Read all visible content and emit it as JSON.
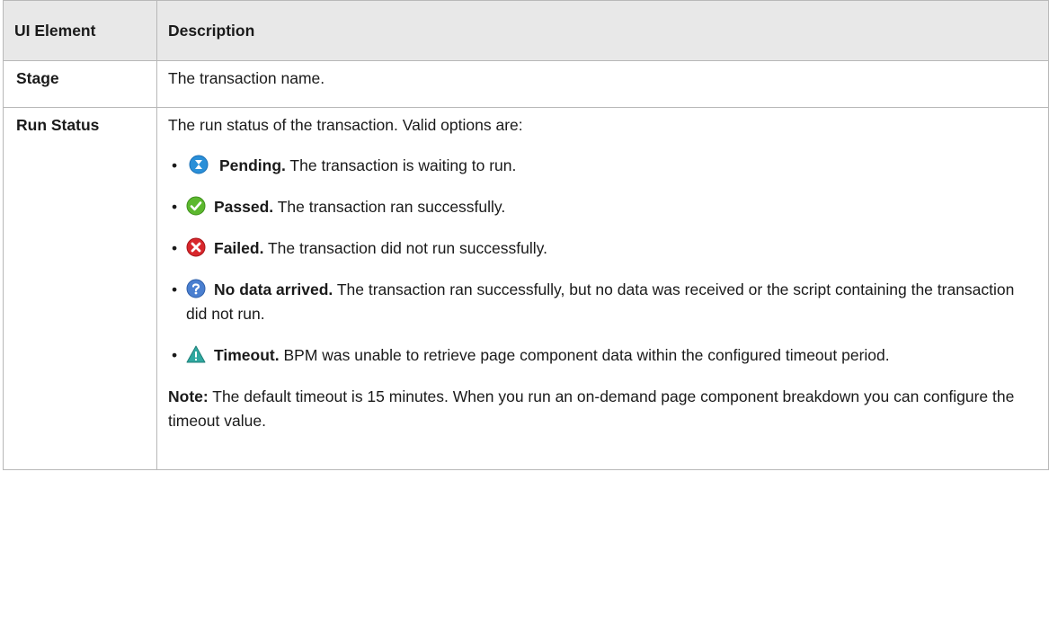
{
  "table": {
    "header": {
      "col1": "UI Element",
      "col2": "Description"
    },
    "rows": {
      "stage": {
        "element": "Stage",
        "description": "The transaction name."
      },
      "run_status": {
        "element": "Run Status",
        "intro": "The run status of the transaction. Valid options are:",
        "options": [
          {
            "icon": "pending-icon",
            "name": "Pending.",
            "text": " The transaction is waiting to run."
          },
          {
            "icon": "passed-check-icon",
            "name": "Passed.",
            "text": " The transaction ran successfully."
          },
          {
            "icon": "failed-x-icon",
            "name": "Failed.",
            "text": " The transaction did not run successfully."
          },
          {
            "icon": "no-data-question-icon",
            "name": "No data arrived.",
            "text": " The transaction ran successfully, but no data was received or the script containing the transaction did not run."
          },
          {
            "icon": "timeout-warning-icon",
            "name": "Timeout.",
            "text": " BPM was unable to retrieve page component data within the configured timeout period."
          }
        ],
        "note_label": "Note:",
        "note_text": " The default timeout is 15 minutes. When you run an on-demand page component breakdown you can configure the timeout value."
      }
    }
  },
  "colors": {
    "header_bg": "#e8e8e8",
    "border": "#b8b8b8",
    "pending_blue": "#2a8fd8",
    "passed_green": "#5cb82e",
    "failed_red": "#d8262b",
    "no_data_blue": "#4a7fd0",
    "timeout_teal": "#2fa8a0"
  }
}
